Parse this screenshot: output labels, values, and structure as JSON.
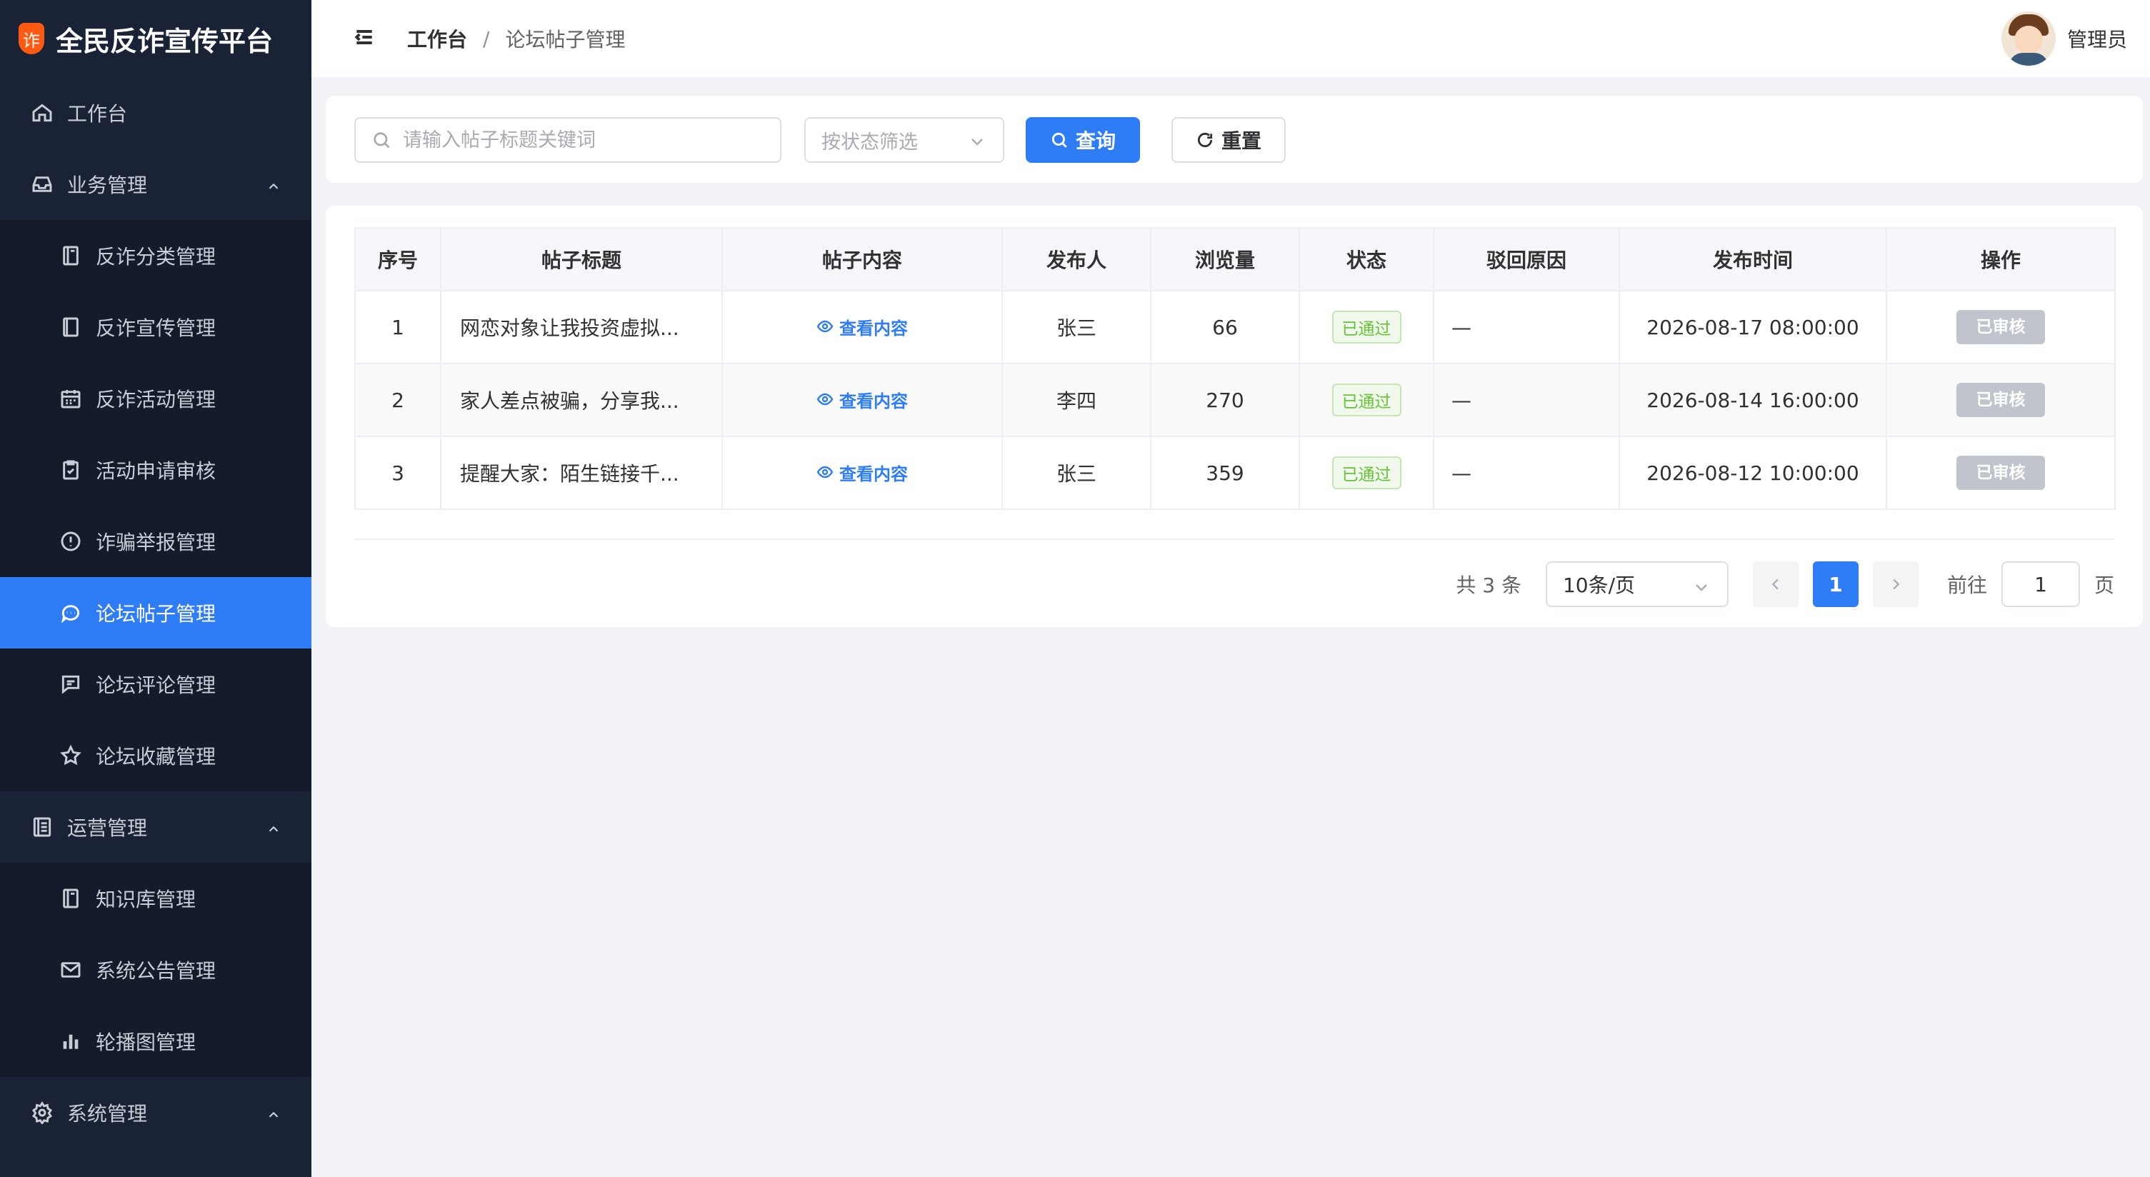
{
  "app": {
    "title": "全民反诈宣传平台",
    "logo_char": "诈"
  },
  "sidebar": {
    "items": [
      {
        "label": "工作台",
        "level": "top",
        "icon": "home-icon"
      },
      {
        "label": "业务管理",
        "level": "top",
        "icon": "inbox-icon",
        "expanded": true
      },
      {
        "label": "反诈分类管理",
        "level": "sub",
        "icon": "notebook-icon"
      },
      {
        "label": "反诈宣传管理",
        "level": "sub",
        "icon": "document-icon"
      },
      {
        "label": "反诈活动管理",
        "level": "sub",
        "icon": "calendar-icon"
      },
      {
        "label": "活动申请审核",
        "level": "sub",
        "icon": "checked-icon"
      },
      {
        "label": "诈骗举报管理",
        "level": "sub",
        "icon": "warning-icon"
      },
      {
        "label": "论坛帖子管理",
        "level": "sub",
        "icon": "chat-dot-icon",
        "active": true
      },
      {
        "label": "论坛评论管理",
        "level": "sub",
        "icon": "chat-square-icon"
      },
      {
        "label": "论坛收藏管理",
        "level": "sub",
        "icon": "star-icon"
      },
      {
        "label": "运营管理",
        "level": "top",
        "icon": "tickets-icon",
        "expanded": true
      },
      {
        "label": "知识库管理",
        "level": "sub",
        "icon": "notebook-icon"
      },
      {
        "label": "系统公告管理",
        "level": "sub",
        "icon": "message-icon"
      },
      {
        "label": "轮播图管理",
        "level": "sub",
        "icon": "histogram-icon"
      },
      {
        "label": "系统管理",
        "level": "top",
        "icon": "setting-icon",
        "expanded": true
      }
    ]
  },
  "header": {
    "breadcrumb": {
      "home": "工作台",
      "separator": "/",
      "current": "论坛帖子管理"
    },
    "user": {
      "name": "管理员"
    }
  },
  "search": {
    "keyword_placeholder": "请输入帖子标题关键词",
    "status_placeholder": "按状态筛选",
    "query_label": "查询",
    "reset_label": "重置"
  },
  "table": {
    "columns": [
      "序号",
      "帖子标题",
      "帖子内容",
      "发布人",
      "浏览量",
      "状态",
      "驳回原因",
      "发布时间",
      "操作"
    ],
    "rows": [
      {
        "index": "1",
        "title": "网恋对象让我投资虚拟...",
        "content_link": "查看内容",
        "author": "张三",
        "views": "66",
        "status": "已通过",
        "reason": "—",
        "time": "2026-08-17 08:00:00",
        "action": "已审核"
      },
      {
        "index": "2",
        "title": "家人差点被骗，分享我...",
        "content_link": "查看内容",
        "author": "李四",
        "views": "270",
        "status": "已通过",
        "reason": "—",
        "time": "2026-08-14 16:00:00",
        "action": "已审核"
      },
      {
        "index": "3",
        "title": "提醒大家：陌生链接千...",
        "content_link": "查看内容",
        "author": "张三",
        "views": "359",
        "status": "已通过",
        "reason": "—",
        "time": "2026-08-12 10:00:00",
        "action": "已审核"
      }
    ]
  },
  "pagination": {
    "total_text": "共 3 条",
    "page_size": "10条/页",
    "current_page": "1",
    "goto_label": "前往",
    "goto_value": "1",
    "page_unit": "页"
  },
  "colors": {
    "primary": "#2f7df6",
    "sidebar_bg": "#1a2235",
    "success": "#67c23a",
    "logo": "#ff5a14"
  }
}
